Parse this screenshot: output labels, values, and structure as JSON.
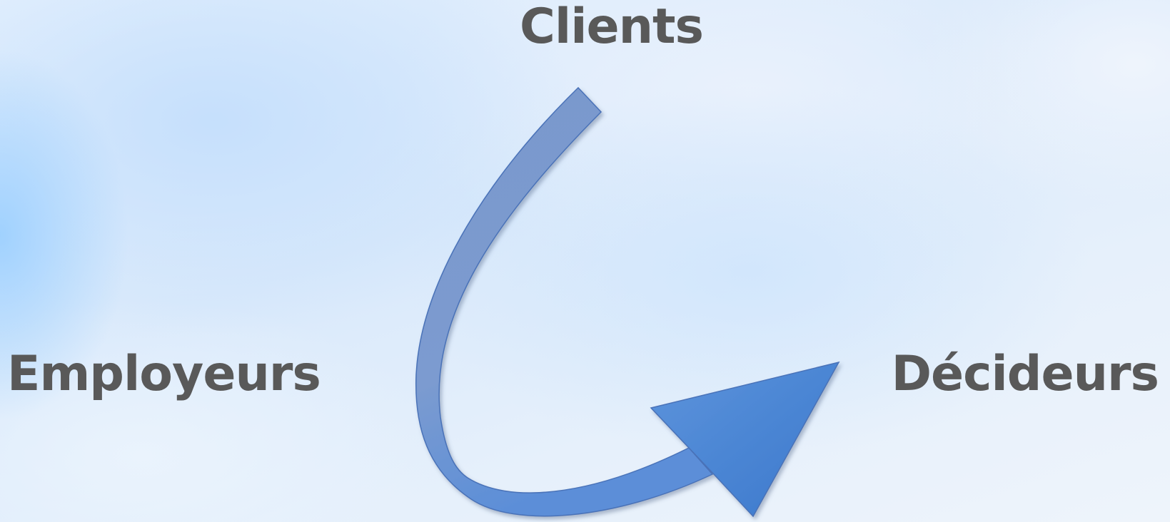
{
  "diagram": {
    "nodes": {
      "clients": "Clients",
      "employeurs": "Employeurs",
      "decideurs": "Décideurs"
    },
    "arrow": {
      "from": "Clients",
      "to": "Décideurs",
      "shape": "curved-arrow",
      "colors": {
        "body_top": "#7a98cc",
        "body_bottom": "#5b8ed8",
        "head": "#3a78cc",
        "outline": "#4a72b8"
      }
    }
  }
}
